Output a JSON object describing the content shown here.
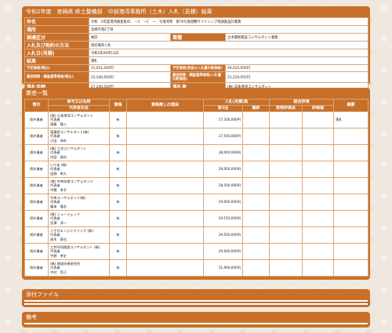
{
  "summary": {
    "title": "令和2年度　宮崎県 県土整備部　中部港湾事務所（土木）入札（見積）結果",
    "rows": {
      "case_name": {
        "label": "件名",
        "value": "令和　2年度港湾調査第41　ー1　ーC　ー　号港湾等　第70号漁港蟹サイドシップ等調査設計業務"
      },
      "location": {
        "label": "場所",
        "value": "宮崎市港2丁目"
      },
      "procurement": {
        "label": "調達区分",
        "value": "委託",
        "type_label": "業種",
        "type_value": "土木関係建設コンサルタント業務"
      },
      "method": {
        "label": "入札及び契約の方法",
        "value": "指名競争入札"
      },
      "bid_date": {
        "label": "入札日(見積)",
        "value": "令和2年09月11日"
      },
      "result": {
        "label": "結果",
        "value": "落札"
      },
      "planned_price": {
        "label": "予定価格(税込)",
        "value": "31,911,000円",
        "label2": "予定価格(税抜)(入札書比較価格)",
        "value2": "29,010,000円"
      },
      "min_price": {
        "label": "最低制限・調査基準価格(税込)",
        "value": "25,540,950円",
        "label2": "最低制限・調査基準価格(入札書比較価格)",
        "value2": "23,219,055円"
      },
      "amount": {
        "label": "落札金額",
        "value": "27,200,000円",
        "winner_label": "落札者",
        "winner_value": "(株) 日本港湾コンサルタント"
      }
    }
  },
  "bidders": {
    "title": "業者一覧",
    "headers": {
      "office": "管内",
      "name": "商号又は名称",
      "rep": "代表者氏名",
      "qual": "資格",
      "reason": "資格無しの理由",
      "bid_group": "入札(見積)高",
      "round1": "第1回",
      "final": "最終",
      "eval_group": "総合評価",
      "tech": "技術評価点",
      "score": "評価値",
      "note": "摘要"
    },
    "rows": [
      {
        "office": "県外業者",
        "name": "(株) 日本港湾コンサルタント",
        "role": "代表者",
        "rep": "遠藤　隆二",
        "qual": "有",
        "bid": "27,200,000円",
        "note": "落札"
      },
      {
        "office": "県外業者",
        "name": "東建設コンサルタント(株)",
        "role": "代表者",
        "rep": "小田　伸夫",
        "qual": "有",
        "bid": "27,500,000円",
        "note": ""
      },
      {
        "office": "県外業者",
        "name": "(株) 三洋コンサルタント",
        "role": "代表者",
        "rep": "内田　昌也",
        "qual": "有",
        "bid": "28,000,000円",
        "note": ""
      },
      {
        "office": "県外業者",
        "name": "いであ (株)",
        "role": "代表者",
        "rep": "田畑　彰久",
        "qual": "有",
        "bid": "28,000,000円",
        "note": ""
      },
      {
        "office": "県外業者",
        "name": "(株) 中央技術コンサルタンツ",
        "role": "代表者",
        "rep": "中関　孝子",
        "qual": "有",
        "bid": "28,500,000円",
        "note": ""
      },
      {
        "office": "県外業者",
        "name": "中央コンサルタンツ(株)",
        "role": "代表者",
        "rep": "藤本　隆志",
        "qual": "有",
        "bid": "29,000,000円",
        "note": ""
      },
      {
        "office": "県外業者",
        "name": "(株) ニュージェック",
        "role": "代表者",
        "rep": "宮澤　淳一",
        "qual": "有",
        "bid": "29,150,000円",
        "note": ""
      },
      {
        "office": "県外業者",
        "name": "八千代エンジニヤリング (株)",
        "role": "代表者",
        "rep": "高木　直也",
        "qual": "有",
        "bid": "29,500,000円",
        "note": ""
      },
      {
        "office": "県外業者",
        "name": "三井共同建設コンサルタント (株)",
        "role": "代表者",
        "rep": "中野　孝史",
        "qual": "有",
        "bid": "29,600,000円",
        "note": ""
      },
      {
        "office": "県外業者",
        "name": "(株) 建設技術研究所",
        "role": "代表者",
        "rep": "中村　哲己",
        "qual": "有",
        "bid": "31,900,000円",
        "note": ""
      }
    ]
  },
  "files": {
    "title": "添付ファイル"
  },
  "remarks": {
    "title": "備考"
  }
}
